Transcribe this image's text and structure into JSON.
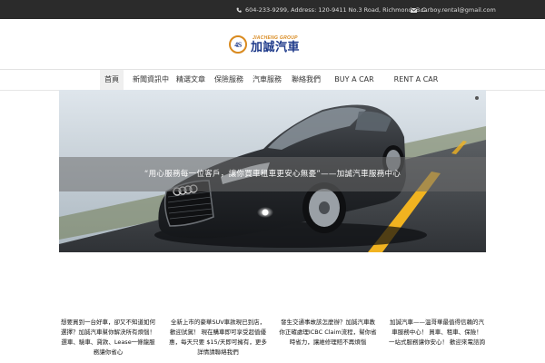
{
  "topbar": {
    "contact": "604-233-9299, Address: 120-9411 No.3 Road, Richmond, B.C.",
    "email": "carboy.rental@gmail.com",
    "icons": {
      "phone": "phone-icon",
      "mail": "mail-icon"
    }
  },
  "logo": {
    "badge": "4S",
    "group": "JIACHENG GROUP",
    "name": "加誠汽車"
  },
  "nav": {
    "items": [
      {
        "label": "首頁"
      },
      {
        "label": "新聞資訊中"
      },
      {
        "label": "精選文章"
      },
      {
        "label": "保險服務"
      },
      {
        "label": "汽車服務"
      },
      {
        "label": "聯絡我們"
      },
      {
        "label": "BUY A CAR"
      },
      {
        "label": "RENT A CAR"
      }
    ]
  },
  "hero": {
    "caption": "“用心服務每一位客戶，讓你買車租車更安心無憂”——加誠汽車服務中心"
  },
  "articles": [
    {
      "text": "想要買到一台好車，卻又不知道如何選擇？加誠汽車幫你解決所有煩惱！選車、驗車、貸款、Lease一條龍服務讓你省心"
    },
    {
      "text": "全新上市的豪華SUV車款現已到店，歡迎試駕！ 現在購車即可享受超值優惠，每天只要 $15/天即可擁有，更多詳情請聯絡我們"
    },
    {
      "text": "發生交通事故該怎麼辦？加誠汽車教你正確處理ICBC Claim流程，幫你省時省力，讓維修理賠不再煩惱"
    },
    {
      "text": "加誠汽車——溫哥華最值得信賴的汽車服務中心！ 買車、租車、保險！ 一站式服務讓你安心！ 歡迎來電諮詢"
    }
  ],
  "colors": {
    "topbar_bg": "#2b2b2b",
    "logo_blue": "#1e3a8a",
    "logo_orange": "#d98a1f",
    "road_line": "#f1b320"
  }
}
